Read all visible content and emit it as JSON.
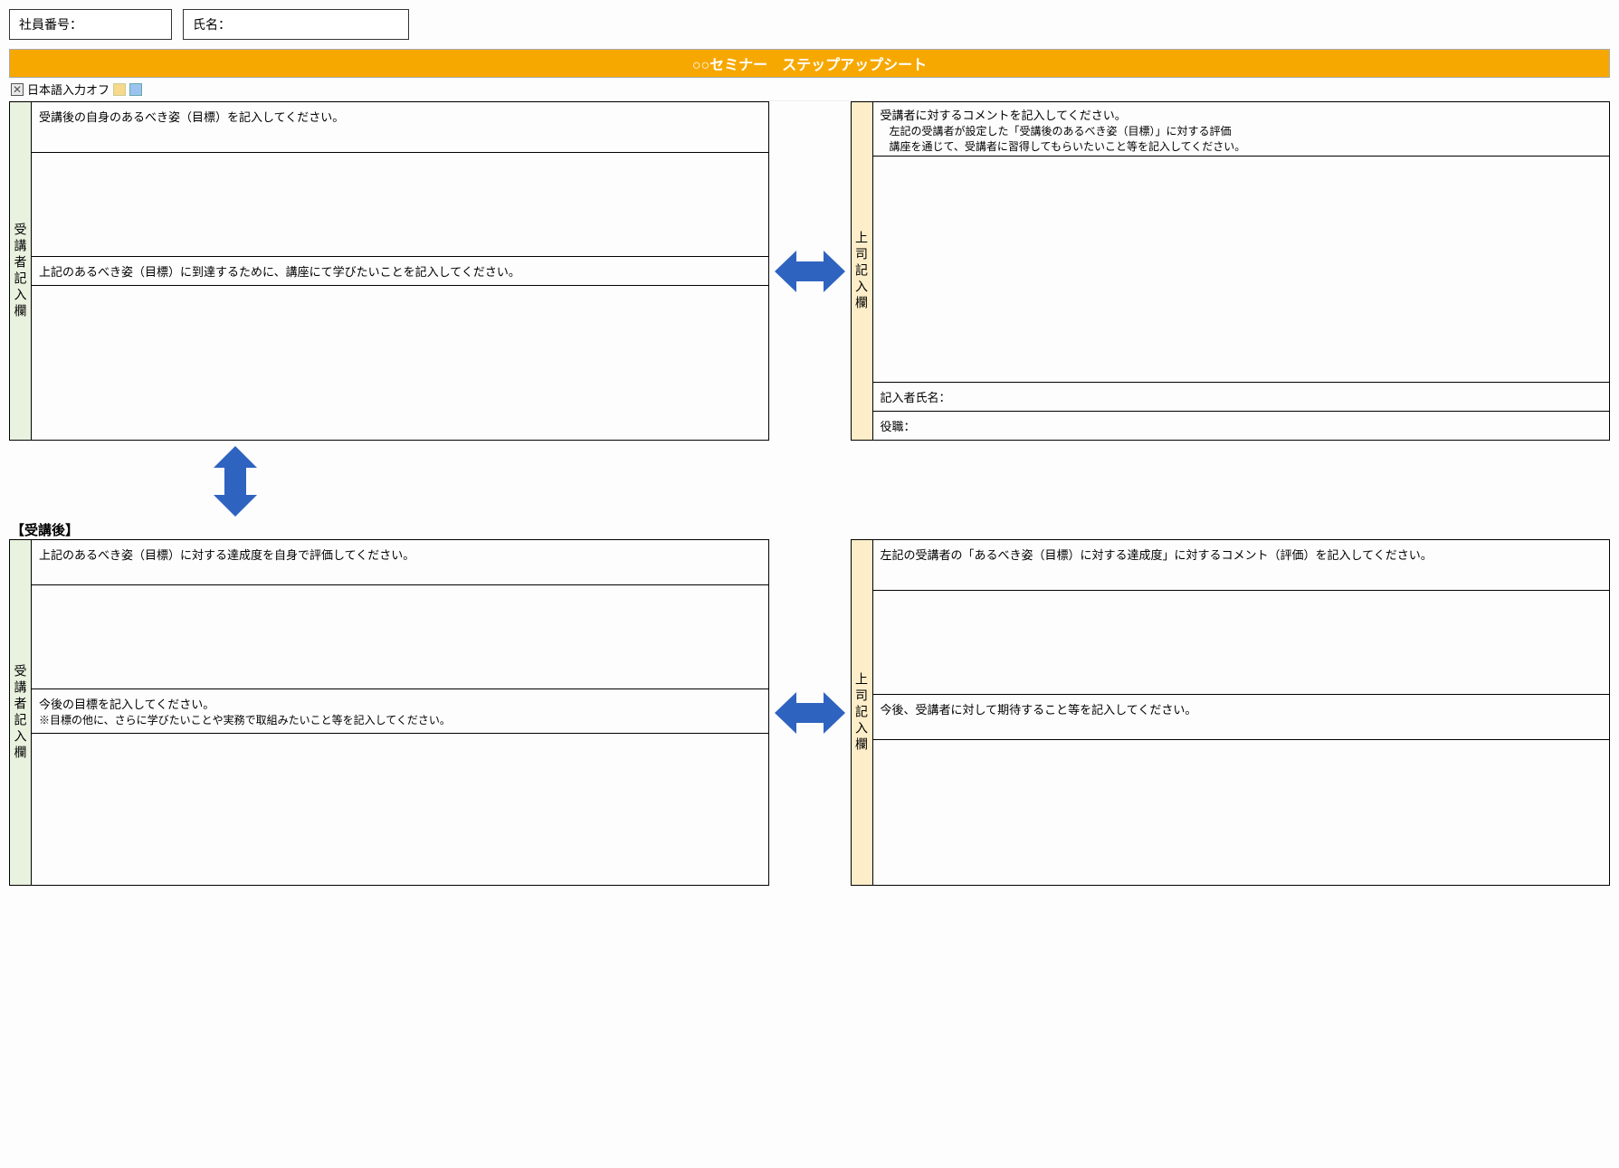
{
  "header": {
    "emp_no_label": "社員番号：",
    "name_label": "氏名：",
    "title": "○○セミナー　ステップアップシート",
    "ime_status": "日本語入力オフ"
  },
  "section_after_label": "【受講後】",
  "left_label": "受講者記入欄",
  "right_label": "上司記入欄",
  "block1": {
    "left": {
      "q1": "受講後の自身のあるべき姿（目標）を記入してください。",
      "q2": "上記のあるべき姿（目標）に到達するために、講座にて学びたいことを記入してください。"
    },
    "right": {
      "header": "受講者に対するコメントを記入してください。",
      "sub1": "左記の受講者が設定した「受講後のあるべき姿（目標）」に対する評価",
      "sub2": "講座を通じて、受講者に習得してもらいたいこと等を記入してください。",
      "signer_name": "記入者氏名：",
      "signer_role": "役職："
    }
  },
  "block2": {
    "left": {
      "q1": "上記のあるべき姿（目標）に対する達成度を自身で評価してください。",
      "q2": "今後の目標を記入してください。",
      "q2_sub": "※目標の他に、さらに学びたいことや実務で取組みたいこと等を記入してください。"
    },
    "right": {
      "q1": "左記の受講者の「あるべき姿（目標）に対する達成度」に対するコメント（評価）を記入してください。",
      "q2": "今後、受講者に対して期待すること等を記入してください。"
    }
  }
}
